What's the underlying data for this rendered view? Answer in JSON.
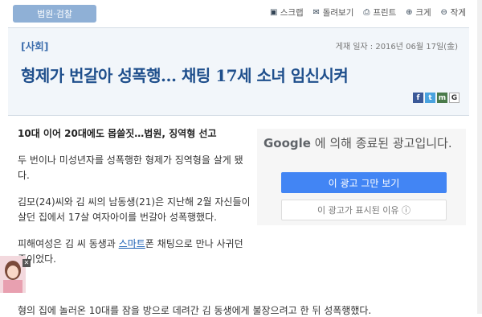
{
  "topbar": {
    "category": "법원·검찰",
    "tools": [
      {
        "icon": "scrap-icon",
        "glyph": "▣",
        "label": "스크랩"
      },
      {
        "icon": "mail-icon",
        "glyph": "✉",
        "label": "돌려보기"
      },
      {
        "icon": "print-icon",
        "glyph": "⎙",
        "label": "프린트"
      },
      {
        "icon": "zoom-in-icon",
        "glyph": "⊕",
        "label": "크게"
      },
      {
        "icon": "zoom-out-icon",
        "glyph": "⊖",
        "label": "작게"
      }
    ]
  },
  "header": {
    "section": "[사회]",
    "pubdate": "게재 일자 : 2016년 06월 17일(金)",
    "headline": "형제가 번갈아 성폭행… 채팅 17세 소녀 임신시켜",
    "share": [
      {
        "icon": "facebook-icon",
        "glyph": "f"
      },
      {
        "icon": "twitter-icon",
        "glyph": "t"
      },
      {
        "icon": "me2day-icon",
        "glyph": "m"
      },
      {
        "icon": "google-icon",
        "glyph": "G"
      }
    ]
  },
  "article": {
    "subhead": "10대 이어 20대에도 몹쓸짓…법원, 징역형 선고",
    "p1": "두 번이나 미성년자를 성폭행한 형제가 징역형을 살게 됐다.",
    "p2": "김모(24)씨와 김 씨의 남동생(21)은 지난해 2월 자신들이 살던 집에서 17살 여자아이를 번갈아 성폭행했다.",
    "p3_pre": "피해여성은 김 씨 동생과 ",
    "p3_link": "스마트",
    "p3_post": "폰 채팅으로 만나 사귀던 중이었다.",
    "overflow": "형의 집에 놀러온 10대를 잠을 방으로 데려간 김 동생에게 불장으려고 한 뒤 성폭행했다."
  },
  "ad": {
    "brand": "Google",
    "text": " 에 의해 종료된 광고입니다.",
    "stop_button": "이 광고 그만 보기",
    "why_button": "이 광고가 표시된 이유 ⓘ"
  },
  "overlay": {
    "close": "✕"
  }
}
